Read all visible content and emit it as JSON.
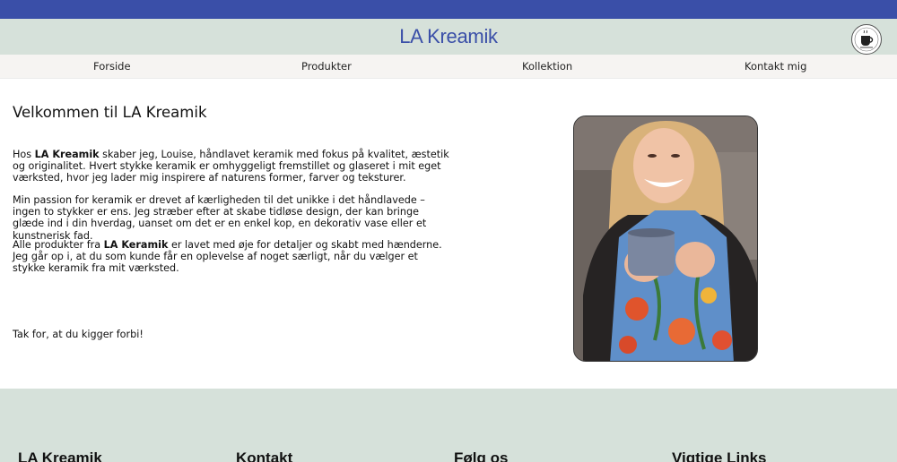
{
  "header": {
    "title": "LA Kreamik",
    "logo_icon": "teacup-logo-icon",
    "brand_color": "#3a4fa8",
    "header_bg": "#d6e1da"
  },
  "nav": {
    "items": [
      {
        "label": "Forside"
      },
      {
        "label": "Produkter"
      },
      {
        "label": "Kollektion"
      },
      {
        "label": "Kontakt mig"
      }
    ]
  },
  "main": {
    "heading": "Velkommen til LA Kreamik",
    "p1": {
      "before": "Hos ",
      "bold": "LA Kreamik",
      "after": " skaber jeg, Louise, håndlavet keramik med fokus på kvalitet, æstetik og originalitet. Hvert stykke keramik er omhyggeligt fremstillet og glaseret i mit eget værksted, hvor jeg lader mig inspirere af naturens former, farver og teksturer."
    },
    "p2": "Min passion for keramik er drevet af kærligheden til det unikke i det håndlavede –ingen to stykker er ens. Jeg stræber efter at skabe tidløse design, der kan bringe glæde ind i din hverdag, uanset om det er en enkel kop, en dekorativ vase eller et kunstnerisk fad.",
    "p3": {
      "before": "Alle produkter fra ",
      "bold": "LA Keramik",
      "after": " er lavet med øje for detaljer og skabt med hænderne. Jeg går op i, at du som kunde får en oplevelse af noget særligt, når du vælger et stykke keramik fra mit værksted."
    },
    "thanks": "Tak for, at du kigger forbi!",
    "photo_icon": "portrait-photo"
  },
  "footer": {
    "columns": [
      {
        "title": "LA Kreamik"
      },
      {
        "title": "Kontakt"
      },
      {
        "title": "Følg os"
      },
      {
        "title": "Vigtige Links"
      }
    ]
  }
}
